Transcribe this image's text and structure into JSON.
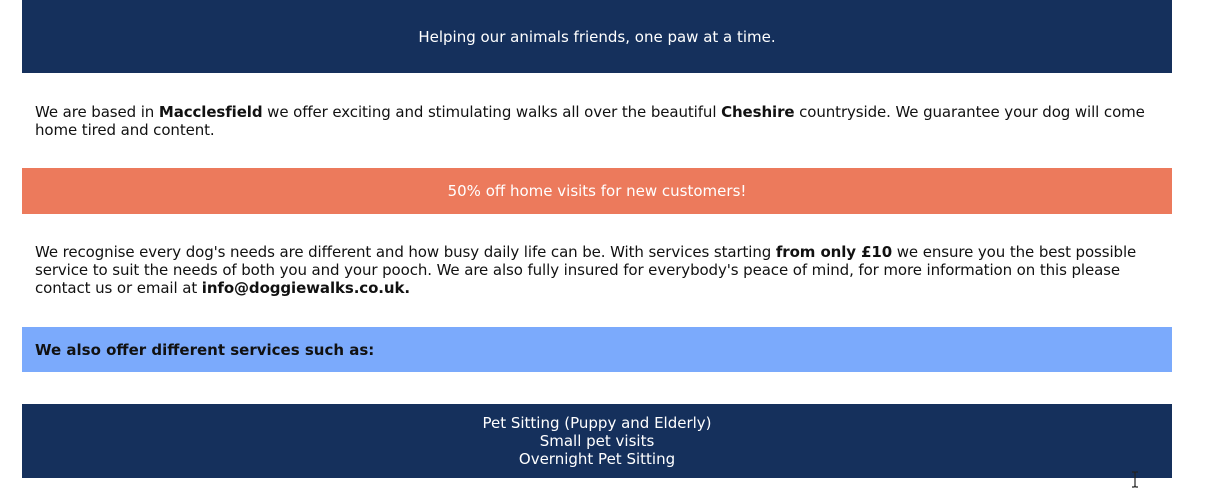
{
  "tagline": "Helping our animals friends, one paw at a time.",
  "intro": {
    "p1": "We are based in ",
    "location": "Macclesfield",
    "p2": " we offer exciting and stimulating walks all over the beautiful ",
    "county": "Cheshire",
    "p3": " countryside. We guarantee your dog will come home tired and content."
  },
  "promo": "50% off home visits for new customers!",
  "services_text": {
    "p1": "We recognise every dog's needs are different and how busy daily life can be. With services starting ",
    "price": "from only £10",
    "p2": " we ensure you the best possible service to suit the needs of both you and your pooch. We are also fully insured for everybody's peace of mind, for more information on this please contact us or email at ",
    "email": "info@doggiewalks.co.uk."
  },
  "offer_heading": "We also offer different services such as:",
  "services_list": [
    "Pet Sitting (Puppy and Elderly)",
    "Small pet visits",
    "Overnight Pet Sitting"
  ],
  "colors": {
    "navy": "#15305c",
    "coral": "#ec7a5c",
    "light_blue": "#7baafc"
  },
  "cursor_icon": "text-cursor-icon"
}
